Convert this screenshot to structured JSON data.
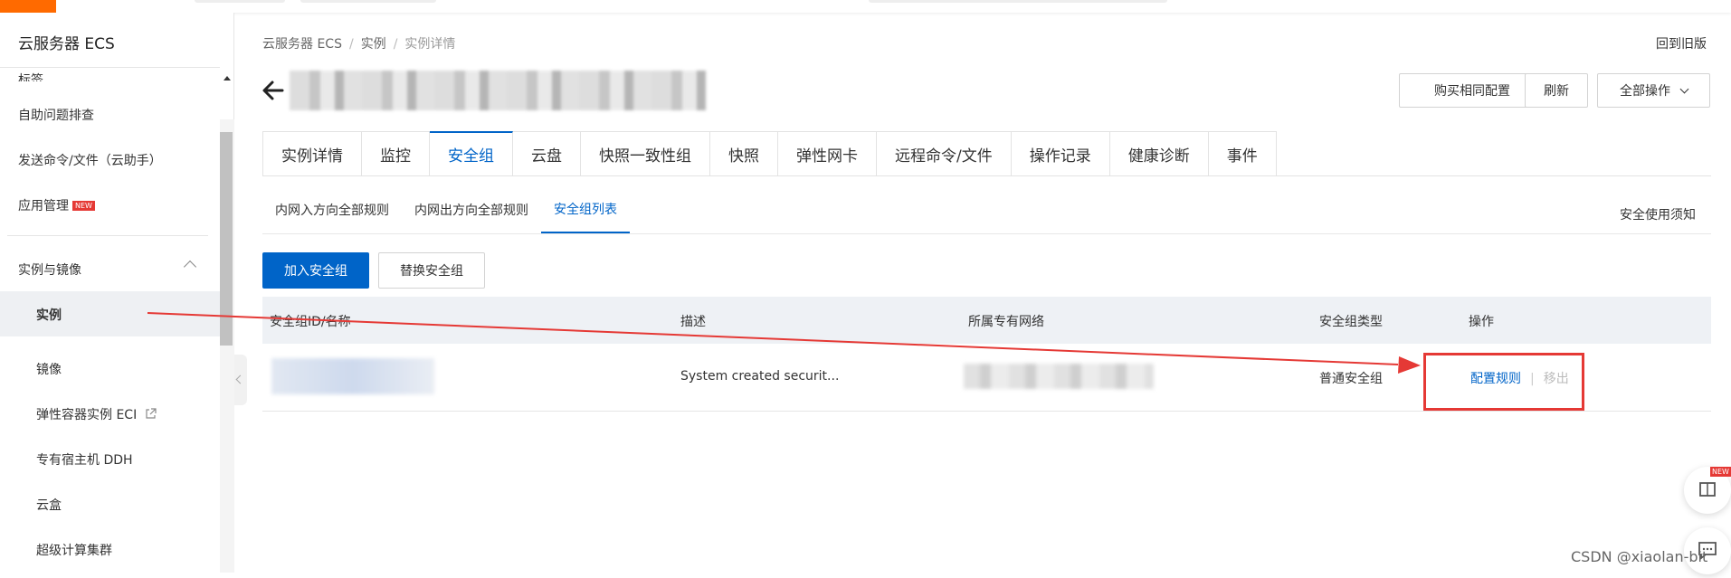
{
  "sidebar": {
    "title": "云服务器 ECS",
    "cut_item": "标签",
    "items": [
      {
        "label": "自助问题排查"
      },
      {
        "label": "发送命令/文件（云助手）"
      },
      {
        "label": "应用管理",
        "badge": "NEW"
      }
    ],
    "group": "实例与镜像",
    "sub_items": [
      {
        "label": "实例"
      },
      {
        "label": "镜像"
      },
      {
        "label": "弹性容器实例 ECI"
      },
      {
        "label": "专有宿主机 DDH"
      },
      {
        "label": "云盒"
      },
      {
        "label": "超级计算集群"
      }
    ]
  },
  "breadcrumb": [
    "云服务器 ECS",
    "实例",
    "实例详情"
  ],
  "header": {
    "old_version": "回到旧版",
    "buttons": {
      "buy_same": "购买相同配置",
      "refresh": "刷新",
      "all_actions": "全部操作"
    }
  },
  "tabs": [
    "实例详情",
    "监控",
    "安全组",
    "云盘",
    "快照一致性组",
    "快照",
    "弹性网卡",
    "远程命令/文件",
    "操作记录",
    "健康诊断",
    "事件"
  ],
  "active_tab": 2,
  "subtabs": [
    "内网入方向全部规则",
    "内网出方向全部规则",
    "安全组列表"
  ],
  "active_subtab": 2,
  "notice": "安全使用须知",
  "actions": {
    "add": "加入安全组",
    "replace": "替换安全组"
  },
  "table": {
    "columns": [
      "安全组ID/名称",
      "描述",
      "所属专有网络",
      "安全组类型",
      "操作"
    ],
    "rows": [
      {
        "description": "System created securit...",
        "type": "普通安全组",
        "op_config": "配置规则",
        "op_remove": "移出"
      }
    ]
  },
  "watermark": "CSDN @xiaolan-bit",
  "float_badge": "NEW",
  "colors": {
    "brand": "#ff6a00",
    "primary": "#0064c8",
    "annotation": "#e53935"
  }
}
